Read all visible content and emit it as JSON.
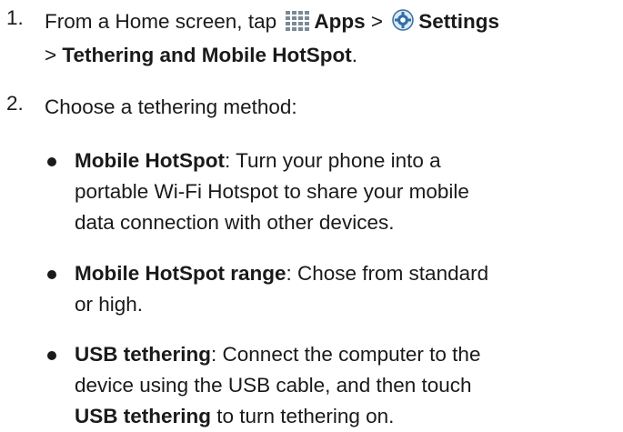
{
  "step1": {
    "number": "1.",
    "prefix": "From a Home screen, tap",
    "apps_label": "Apps",
    "sep1": ">",
    "settings_label": "Settings",
    "sep2": ">",
    "tethering_label": "Tethering and Mobile HotSpot",
    "end": ".",
    "apps_icon": "apps-grid-icon",
    "settings_icon": "settings-gear-icon",
    "icon_colors": {
      "apps": "#7a8a99",
      "settings": "#2f6fa8"
    }
  },
  "step2": {
    "number": "2.",
    "text": "Choose a tethering method:"
  },
  "bullets": [
    {
      "term": "Mobile HotSpot",
      "colon": ":",
      "line1_rest": " Turn your phone into a",
      "line2": "portable Wi-Fi Hotspot to share your mobile",
      "line3": "data connection with other devices."
    },
    {
      "term": "Mobile HotSpot range",
      "colon": ":",
      "line1_rest": " Chose from standard",
      "line2": "or high."
    },
    {
      "term": "USB tethering",
      "colon": ":",
      "line1_rest": " Connect the computer to the",
      "line2": "device using the USB cable, and then touch",
      "line3_term": "USB tethering",
      "line3_rest": " to turn tethering on."
    }
  ]
}
